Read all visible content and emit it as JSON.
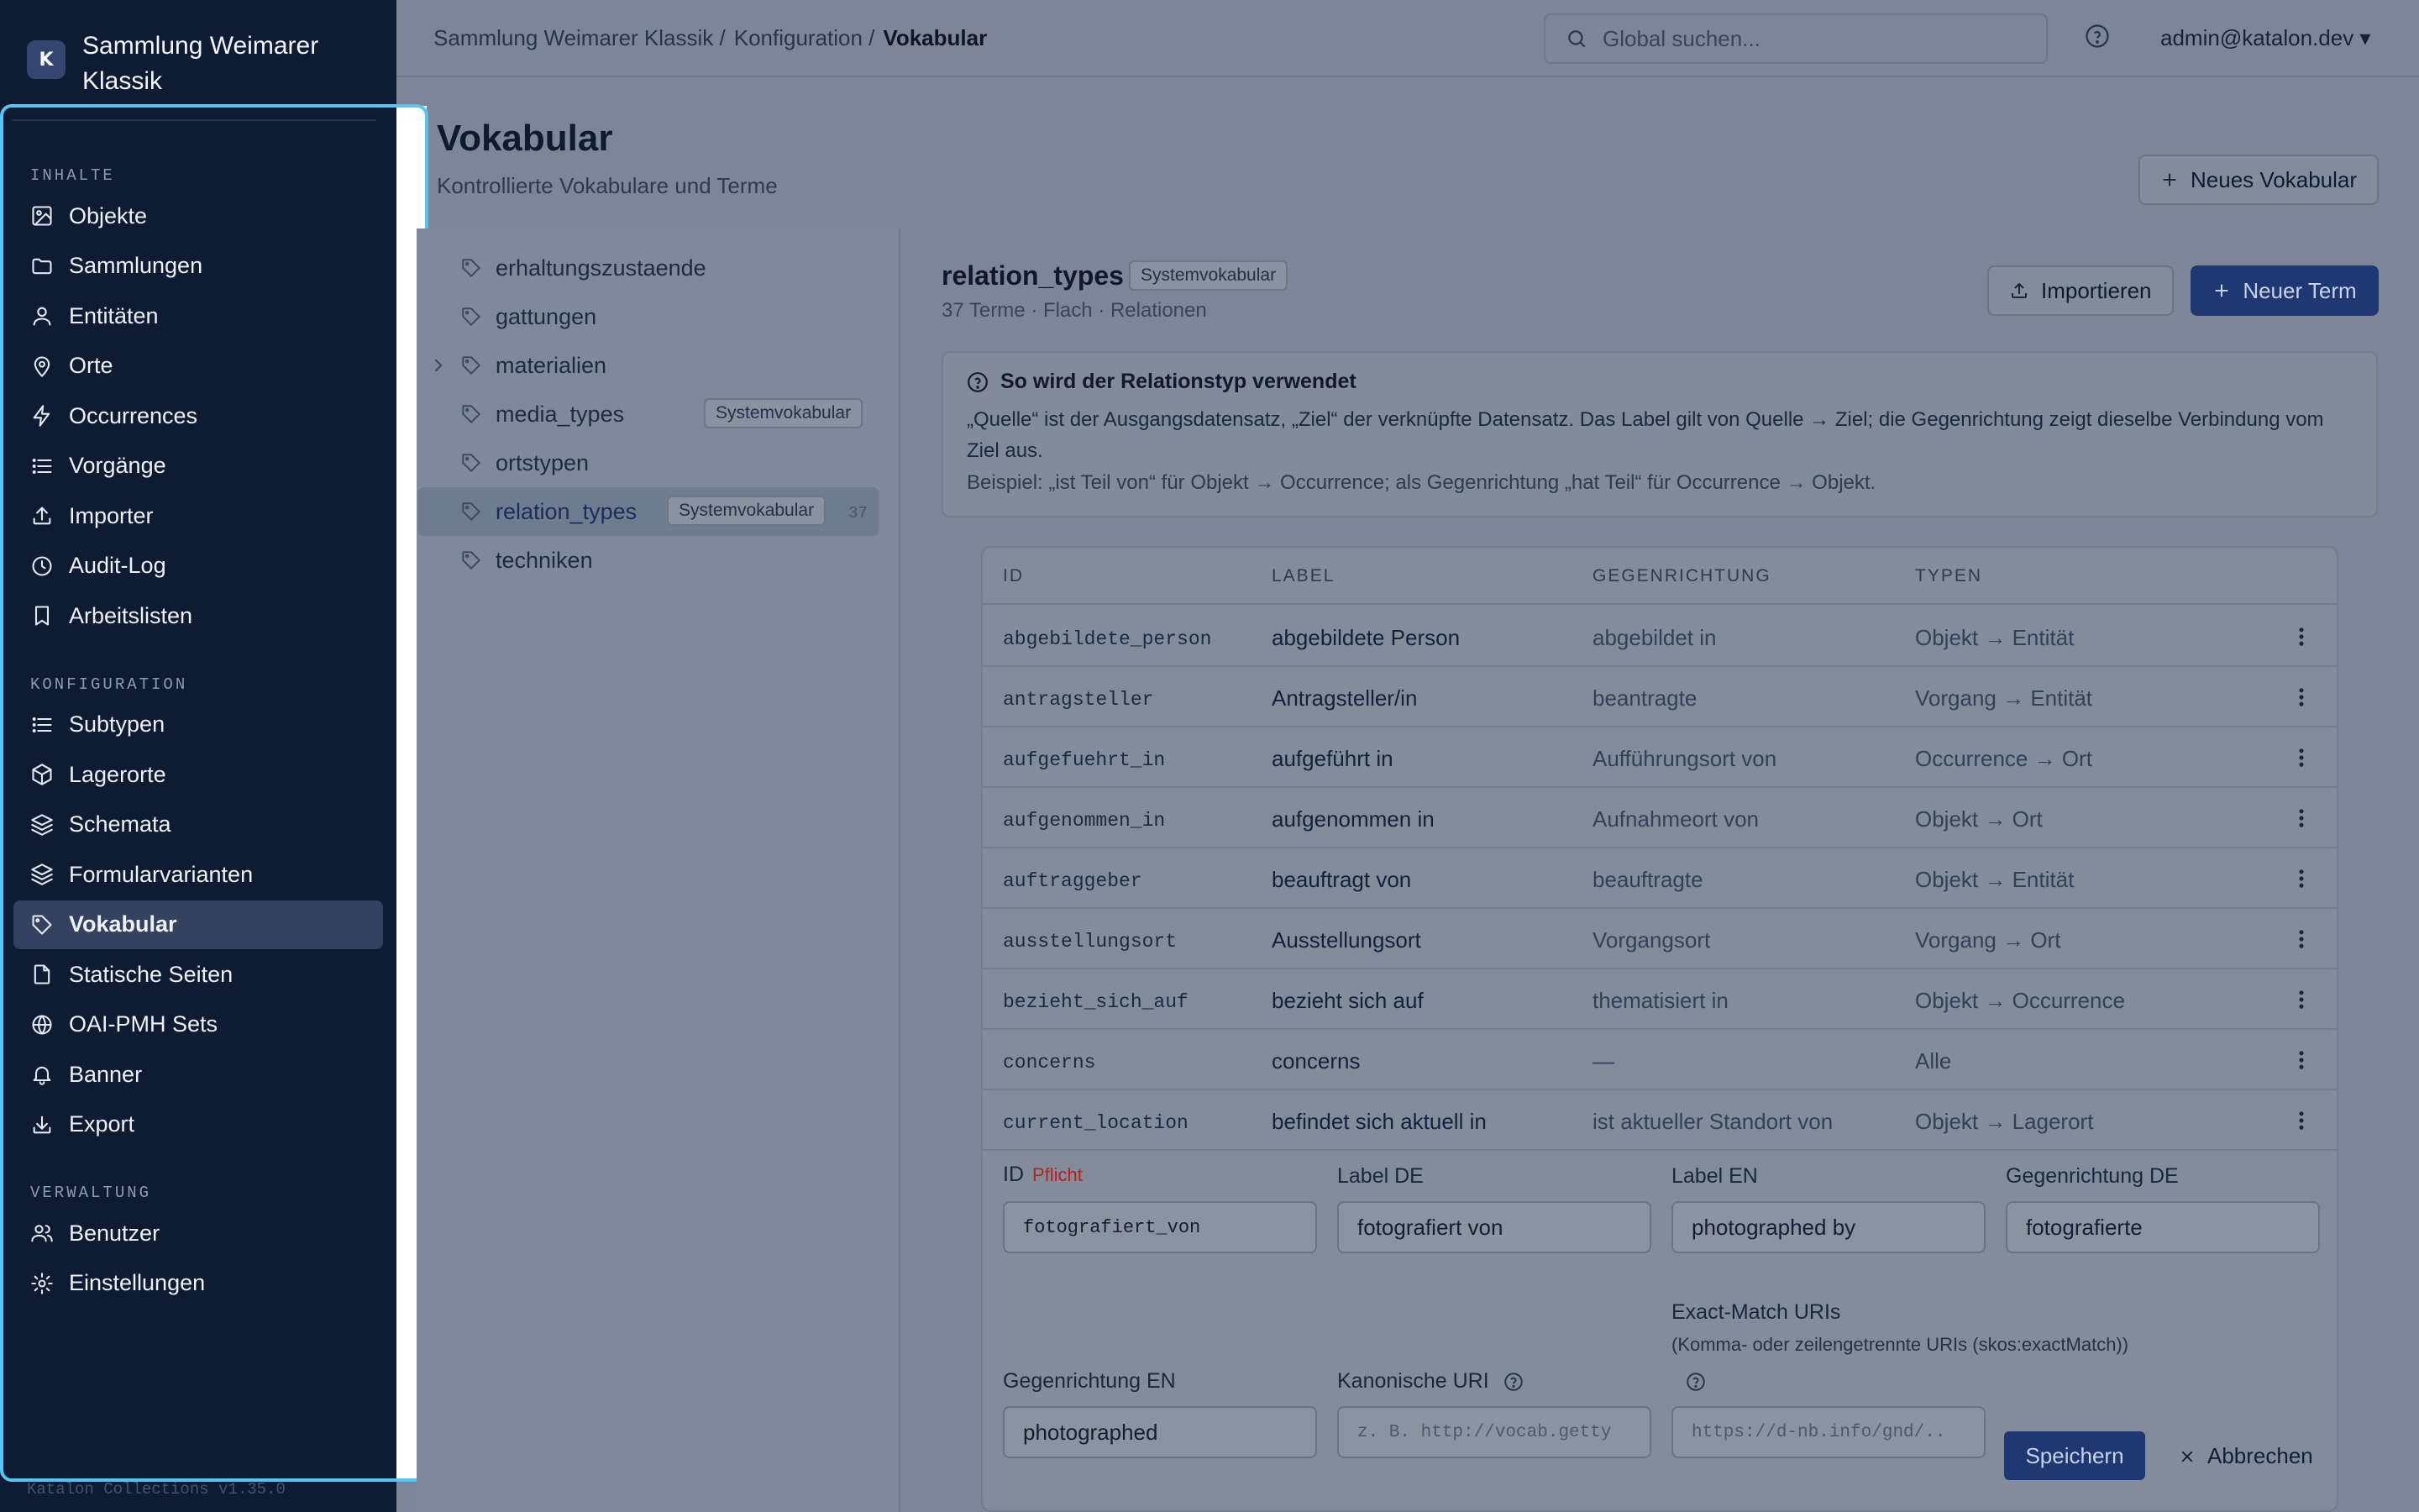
{
  "app": {
    "logo_letter": "K",
    "name": "Sammlung Weimarer Klassik",
    "version": "Katalon Collections v1.35.0"
  },
  "sidebar": {
    "sections": [
      {
        "label": "INHALTE",
        "items": [
          {
            "label": "Objekte",
            "icon": "image-icon"
          },
          {
            "label": "Sammlungen",
            "icon": "folder-icon"
          },
          {
            "label": "Entitäten",
            "icon": "user-icon"
          },
          {
            "label": "Orte",
            "icon": "map-pin-icon"
          },
          {
            "label": "Occurrences",
            "icon": "lightning-icon"
          },
          {
            "label": "Vorgänge",
            "icon": "list-icon"
          },
          {
            "label": "Importer",
            "icon": "upload-icon"
          },
          {
            "label": "Audit-Log",
            "icon": "clock-icon"
          },
          {
            "label": "Arbeitslisten",
            "icon": "bookmark-icon"
          }
        ]
      },
      {
        "label": "KONFIGURATION",
        "items": [
          {
            "label": "Subtypen",
            "icon": "list-icon"
          },
          {
            "label": "Lagerorte",
            "icon": "box-icon"
          },
          {
            "label": "Schemata",
            "icon": "layers-icon"
          },
          {
            "label": "Formularvarianten",
            "icon": "layers-icon"
          },
          {
            "label": "Vokabular",
            "icon": "tag-icon",
            "active": true
          },
          {
            "label": "Statische Seiten",
            "icon": "file-icon"
          },
          {
            "label": "OAI-PMH Sets",
            "icon": "globe-icon"
          },
          {
            "label": "Banner",
            "icon": "bell-icon"
          },
          {
            "label": "Export",
            "icon": "download-icon"
          }
        ]
      },
      {
        "label": "VERWALTUNG",
        "items": [
          {
            "label": "Benutzer",
            "icon": "users-icon"
          },
          {
            "label": "Einstellungen",
            "icon": "gear-icon"
          }
        ]
      }
    ]
  },
  "topbar": {
    "breadcrumb": [
      "Sammlung Weimarer Klassik /",
      "Konfiguration /",
      "Vokabular"
    ],
    "search_placeholder": "Global suchen...",
    "user": "admin@katalon.dev ▾"
  },
  "page": {
    "title": "Vokabular",
    "subtitle": "Kontrollierte Vokabulare und Terme",
    "new_vocab_button": "Neues Vokabular"
  },
  "vocab_list": [
    {
      "name": "erhaltungszustaende"
    },
    {
      "name": "gattungen"
    },
    {
      "name": "materialien",
      "expandable": true
    },
    {
      "name": "media_types",
      "badge": "Systemvokabular"
    },
    {
      "name": "ortstypen"
    },
    {
      "name": "relation_types",
      "badge": "Systemvokabular",
      "count": "37",
      "active": true
    },
    {
      "name": "techniken"
    }
  ],
  "detail": {
    "title": "relation_types",
    "badge": "Systemvokabular",
    "meta": "37 Terme · Flach · Relationen",
    "import_button": "Importieren",
    "new_term_button": "Neuer Term",
    "info": {
      "heading": "So wird der Relationstyp verwendet",
      "text": "„Quelle“ ist der Ausgangsdatensatz, „Ziel“ der verknüpfte Datensatz. Das Label gilt von Quelle → Ziel; die Gegenrichtung zeigt dieselbe Verbindung vom Ziel aus.",
      "example": "Beispiel: „ist Teil von“ für Objekt → Occurrence; als Gegenrichtung „hat Teil“ für Occurrence → Objekt."
    }
  },
  "table": {
    "headers": [
      "ID",
      "LABEL",
      "GEGENRICHTUNG",
      "TYPEN"
    ],
    "rows": [
      [
        "abgebildete_person",
        "abgebildete Person",
        "abgebildet in",
        "Objekt → Entität"
      ],
      [
        "antragsteller",
        "Antragsteller/in",
        "beantragte",
        "Vorgang → Entität"
      ],
      [
        "aufgefuehrt_in",
        "aufgeführt in",
        "Aufführungsort von",
        "Occurrence → Ort"
      ],
      [
        "aufgenommen_in",
        "aufgenommen in",
        "Aufnahmeort von",
        "Objekt → Ort"
      ],
      [
        "auftraggeber",
        "beauftragt von",
        "beauftragte",
        "Objekt → Entität"
      ],
      [
        "ausstellungsort",
        "Ausstellungsort",
        "Vorgangsort",
        "Vorgang → Ort"
      ],
      [
        "bezieht_sich_auf",
        "bezieht sich auf",
        "thematisiert in",
        "Objekt → Occurrence"
      ],
      [
        "concerns",
        "concerns",
        "—",
        "Alle"
      ],
      [
        "current_location",
        "befindet sich aktuell in",
        "ist aktueller Standort von",
        "Objekt → Lagerort"
      ]
    ]
  },
  "form": {
    "id_label": "ID",
    "required": "Pflicht",
    "id_value": "fotografiert_von",
    "label_de": "Label DE",
    "label_de_value": "fotografiert von",
    "label_en": "Label EN",
    "label_en_value": "photographed by",
    "inverse_de": "Gegenrichtung DE",
    "inverse_de_value": "fotografierte",
    "exact_match_label": "Exact-Match URIs",
    "exact_match_hint": "(Komma- oder zeilengetrennte URIs (skos:exactMatch))",
    "inverse_en": "Gegenrichtung EN",
    "inverse_en_value": "photographed",
    "canonical_uri": "Kanonische URI",
    "canonical_placeholder": "z. B. http://vocab.getty",
    "exact_match_placeholder": "https://d-nb.info/gnd/..",
    "save": "Speichern",
    "cancel": "Abbrechen"
  },
  "colors": {
    "sidebar_bg": "#0f1b33",
    "primary": "#1f3772",
    "focus_ring": "#58c3f0",
    "required": "#b5231f"
  }
}
